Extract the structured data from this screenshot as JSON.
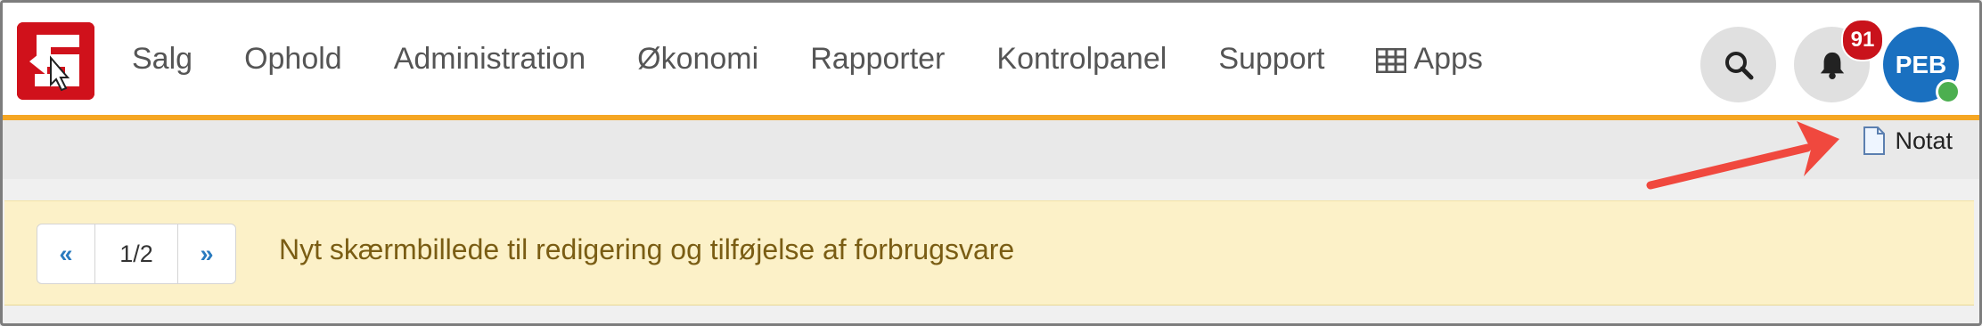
{
  "nav": {
    "items": [
      {
        "label": "Salg"
      },
      {
        "label": "Ophold"
      },
      {
        "label": "Administration"
      },
      {
        "label": "Økonomi"
      },
      {
        "label": "Rapporter"
      },
      {
        "label": "Kontrolpanel"
      },
      {
        "label": "Support"
      },
      {
        "label": "Apps",
        "icon": "grid-icon"
      }
    ],
    "notifications_count": "91",
    "user_initials": "PEB"
  },
  "toolbar": {
    "note_label": "Notat",
    "note_icon": "document-icon"
  },
  "banner": {
    "prev": "«",
    "page": "1/2",
    "next": "»",
    "message": "Nyt skærmbillede til redigering og tilføjelse af forbrugsvare"
  },
  "colors": {
    "brand_red": "#d0111b",
    "accent_orange": "#f5a623",
    "avatar_blue": "#1a70c0",
    "badge_red": "#c9121b",
    "banner_bg": "#fcf1c8",
    "banner_text": "#7a5d14",
    "arrow_red": "#f0483e"
  }
}
